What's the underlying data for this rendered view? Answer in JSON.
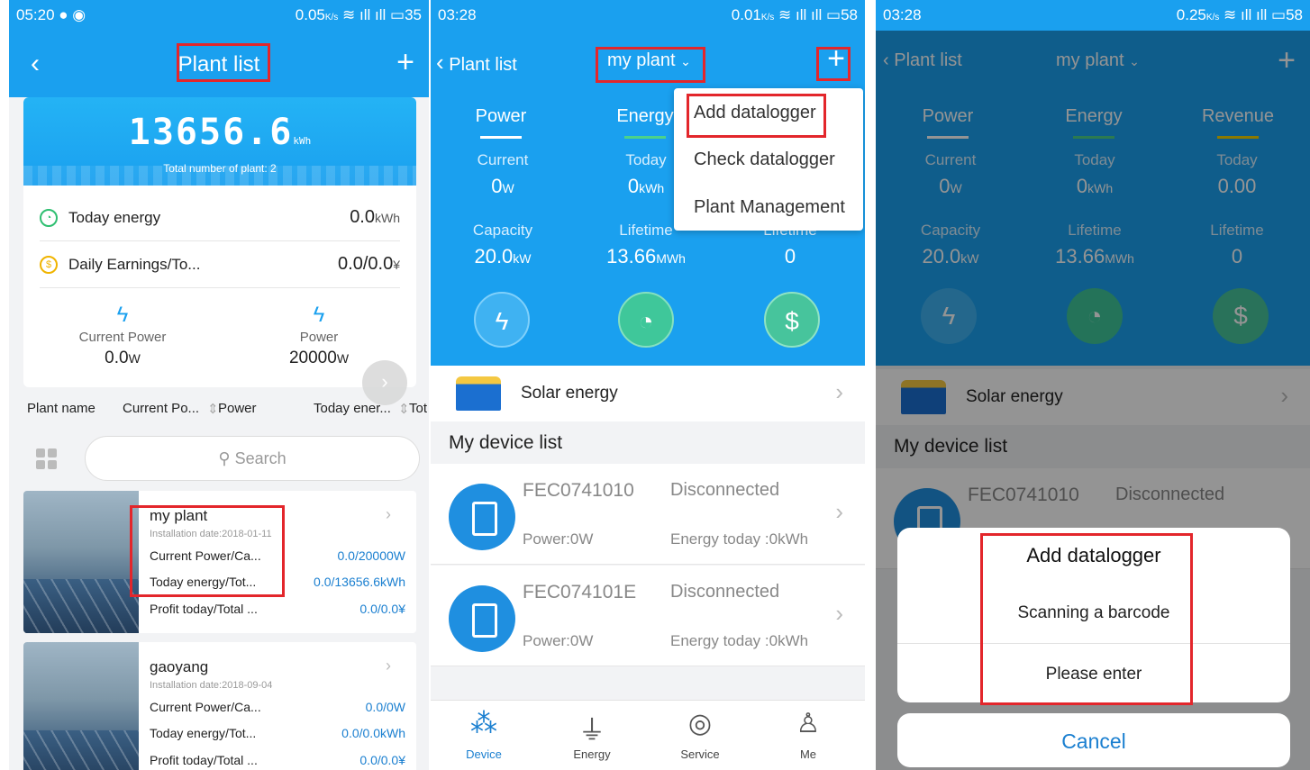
{
  "screen1": {
    "status": {
      "time": "05:20",
      "net": "0.05",
      "net_unit": "K/s",
      "battery": "35"
    },
    "nav": {
      "title": "Plant list",
      "back": "‹",
      "plus": "+"
    },
    "summary": {
      "energy": "13656.6",
      "energy_unit": "kWh",
      "total_plants": "Total number of plant: 2"
    },
    "today_energy": {
      "label": "Today energy",
      "value": "0.0",
      "unit": "kWh"
    },
    "daily_earnings": {
      "label": "Daily Earnings/To...",
      "value": "0.0/0.0",
      "unit": "¥"
    },
    "current_power": {
      "label": "Current Power",
      "value": "0.0",
      "unit": "W"
    },
    "power": {
      "label": "Power",
      "value": "20000",
      "unit": "W"
    },
    "columns": [
      "Plant name",
      "Current Po...",
      "Power",
      "Today ener...",
      "Tot"
    ],
    "search_placeholder": "Search",
    "plants": [
      {
        "name": "my plant",
        "date": "Installation date:2018-01-11",
        "l1": "Current Power/Ca...",
        "v1": "0.0/20000W",
        "l2": "Today energy/Tot...",
        "v2": "0.0/13656.6kWh",
        "l3": "Profit today/Total ...",
        "v3": "0.0/0.0¥"
      },
      {
        "name": "gaoyang",
        "date": "Installation date:2018-09-04",
        "l1": "Current Power/Ca...",
        "v1": "0.0/0W",
        "l2": "Today energy/Tot...",
        "v2": "0.0/0.0kWh",
        "l3": "Profit today/Total ...",
        "v3": "0.0/0.0¥"
      }
    ]
  },
  "screen2": {
    "status": {
      "time": "03:28",
      "net": "0.01",
      "net_unit": "K/s",
      "battery": "58"
    },
    "nav": {
      "back_label": "Plant list",
      "title": "my plant",
      "plus": "+"
    },
    "tabs": {
      "power": "Power",
      "energy": "Energy",
      "revenue": "Revenue"
    },
    "stats": {
      "current_label": "Current",
      "current_value": "0",
      "current_unit": "W",
      "today_label": "Today",
      "today_value": "0",
      "today_unit": "kWh",
      "capacity_label": "Capacity",
      "capacity_value": "20.0",
      "capacity_unit": "kW",
      "lifetime_label": "Lifetime",
      "lifetime_value": "13.66",
      "lifetime_unit": "MWh",
      "lifetime2_label": "Lifetime",
      "lifetime2_value": "0"
    },
    "menu": {
      "add": "Add datalogger",
      "check": "Check datalogger",
      "manage": "Plant Management"
    },
    "solar": "Solar energy",
    "device_list_title": "My device list",
    "devices": [
      {
        "sn": "FEC0741010",
        "status": "Disconnected",
        "power": "Power:0W",
        "energy": "Energy today :0kWh"
      },
      {
        "sn": "FEC074101E",
        "status": "Disconnected",
        "power": "Power:0W",
        "energy": "Energy today :0kWh"
      }
    ],
    "tabbar": {
      "device": "Device",
      "energy": "Energy",
      "service": "Service",
      "me": "Me"
    }
  },
  "screen3": {
    "status": {
      "time": "03:28",
      "net": "0.25",
      "net_unit": "K/s",
      "battery": "58"
    },
    "nav": {
      "back_label": "Plant list",
      "title": "my plant"
    },
    "tabs": {
      "power": "Power",
      "energy": "Energy",
      "revenue": "Revenue"
    },
    "stats": {
      "current_label": "Current",
      "current_value": "0",
      "current_unit": "W",
      "today_label": "Today",
      "today_value": "0",
      "today_unit": "kWh",
      "today2_label": "Today",
      "today2_value": "0.00",
      "capacity_label": "Capacity",
      "capacity_value": "20.0",
      "capacity_unit": "kW",
      "lifetime_label": "Lifetime",
      "lifetime_value": "13.66",
      "lifetime_unit": "MWh",
      "lifetime2_label": "Lifetime",
      "lifetime2_value": "0"
    },
    "solar": "Solar energy",
    "device_list_title": "My device list",
    "device": {
      "sn": "FEC0741010",
      "status": "Disconnected"
    },
    "sheet": {
      "title": "Add datalogger",
      "scan": "Scanning a barcode",
      "enter": "Please enter",
      "cancel": "Cancel"
    }
  },
  "colors": {
    "primary": "#1aa0ef",
    "highlight": "#e3262b",
    "link": "#1a7fd0"
  }
}
